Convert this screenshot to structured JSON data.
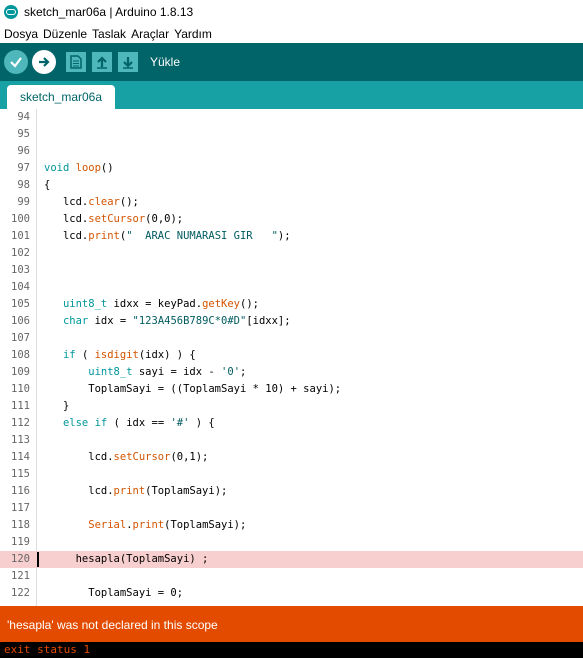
{
  "window": {
    "title": "sketch_mar06a | Arduino 1.8.13"
  },
  "menu": [
    "Dosya",
    "Düzenle",
    "Taslak",
    "Araçlar",
    "Yardım"
  ],
  "toolbar": {
    "hover_label": "Yükle"
  },
  "tab": {
    "label": "sketch_mar06a"
  },
  "lines": [
    {
      "n": "94",
      "tokens": []
    },
    {
      "n": "95",
      "tokens": []
    },
    {
      "n": "96",
      "tokens": []
    },
    {
      "n": "97",
      "tokens": [
        {
          "t": "void",
          "c": "kw"
        },
        {
          "t": " "
        },
        {
          "t": "loop",
          "c": "fn"
        },
        {
          "t": "()"
        }
      ]
    },
    {
      "n": "98",
      "tokens": [
        {
          "t": "{"
        }
      ]
    },
    {
      "n": "99",
      "tokens": [
        {
          "t": "   lcd."
        },
        {
          "t": "clear",
          "c": "fn"
        },
        {
          "t": "();"
        }
      ]
    },
    {
      "n": "100",
      "tokens": [
        {
          "t": "   lcd."
        },
        {
          "t": "setCursor",
          "c": "fn"
        },
        {
          "t": "(0,0);"
        }
      ]
    },
    {
      "n": "101",
      "tokens": [
        {
          "t": "   lcd."
        },
        {
          "t": "print",
          "c": "fn"
        },
        {
          "t": "("
        },
        {
          "t": "\"  ARAC NUMARASI GIR   \"",
          "c": "str"
        },
        {
          "t": ");"
        }
      ]
    },
    {
      "n": "102",
      "tokens": []
    },
    {
      "n": "103",
      "tokens": []
    },
    {
      "n": "104",
      "tokens": []
    },
    {
      "n": "105",
      "tokens": [
        {
          "t": "   "
        },
        {
          "t": "uint8_t",
          "c": "kw"
        },
        {
          "t": " idxx = keyPad."
        },
        {
          "t": "getKey",
          "c": "fn"
        },
        {
          "t": "();"
        }
      ]
    },
    {
      "n": "106",
      "tokens": [
        {
          "t": "   "
        },
        {
          "t": "char",
          "c": "kw"
        },
        {
          "t": " idx = "
        },
        {
          "t": "\"123A456B789C*0#D\"",
          "c": "str"
        },
        {
          "t": "[idxx];"
        }
      ]
    },
    {
      "n": "107",
      "tokens": []
    },
    {
      "n": "108",
      "tokens": [
        {
          "t": "   "
        },
        {
          "t": "if",
          "c": "kw"
        },
        {
          "t": " ( "
        },
        {
          "t": "isdigit",
          "c": "fn"
        },
        {
          "t": "(idx) ) {"
        }
      ]
    },
    {
      "n": "109",
      "tokens": [
        {
          "t": "       "
        },
        {
          "t": "uint8_t",
          "c": "kw"
        },
        {
          "t": " sayi = idx - "
        },
        {
          "t": "'0'",
          "c": "str"
        },
        {
          "t": ";"
        }
      ]
    },
    {
      "n": "110",
      "tokens": [
        {
          "t": "       ToplamSayi = ((ToplamSayi * 10) + sayi);"
        }
      ]
    },
    {
      "n": "111",
      "tokens": [
        {
          "t": "   }"
        }
      ]
    },
    {
      "n": "112",
      "tokens": [
        {
          "t": "   "
        },
        {
          "t": "else",
          "c": "kw"
        },
        {
          "t": " "
        },
        {
          "t": "if",
          "c": "kw"
        },
        {
          "t": " ( idx == "
        },
        {
          "t": "'#'",
          "c": "str"
        },
        {
          "t": " ) {"
        }
      ]
    },
    {
      "n": "113",
      "tokens": []
    },
    {
      "n": "114",
      "tokens": [
        {
          "t": "       lcd."
        },
        {
          "t": "setCursor",
          "c": "fn"
        },
        {
          "t": "(0,1);"
        }
      ]
    },
    {
      "n": "115",
      "tokens": []
    },
    {
      "n": "116",
      "tokens": [
        {
          "t": "       lcd."
        },
        {
          "t": "print",
          "c": "fn"
        },
        {
          "t": "(ToplamSayi);"
        }
      ]
    },
    {
      "n": "117",
      "tokens": []
    },
    {
      "n": "118",
      "tokens": [
        {
          "t": "       "
        },
        {
          "t": "Serial",
          "c": "fn"
        },
        {
          "t": "."
        },
        {
          "t": "print",
          "c": "fn"
        },
        {
          "t": "(ToplamSayi);"
        }
      ]
    },
    {
      "n": "119",
      "tokens": []
    },
    {
      "n": "120",
      "tokens": [
        {
          "t": "     hesapla(ToplamSayi) ;"
        }
      ],
      "highlight": true
    },
    {
      "n": "121",
      "tokens": []
    },
    {
      "n": "122",
      "tokens": [
        {
          "t": "       ToplamSayi = 0;"
        }
      ]
    }
  ],
  "error_message": "'hesapla' was not declared in this scope",
  "console_text": "exit status 1"
}
